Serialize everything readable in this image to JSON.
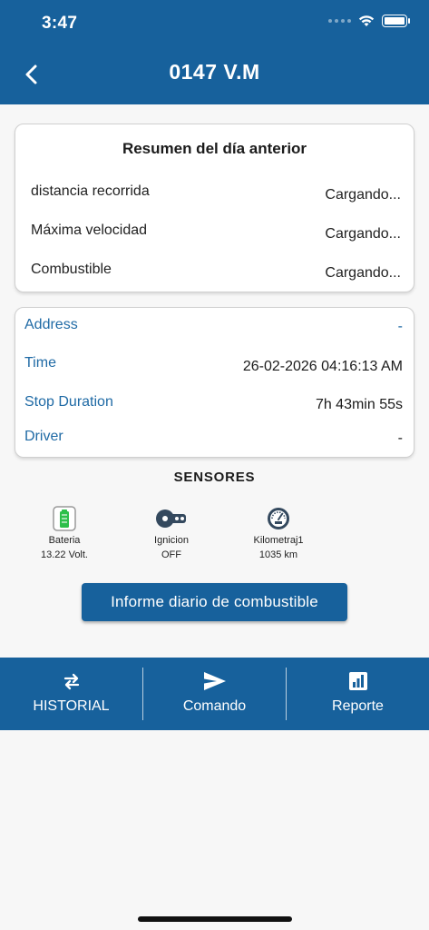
{
  "status_bar": {
    "time": "3:47"
  },
  "header": {
    "title": "0147 V.M"
  },
  "summary": {
    "title": "Resumen del día anterior",
    "rows": [
      {
        "label": "distancia recorrida",
        "value": "Cargando..."
      },
      {
        "label": "Máxima velocidad",
        "value": "Cargando..."
      },
      {
        "label": "Combustible",
        "value": "Cargando..."
      }
    ]
  },
  "info": {
    "rows": [
      {
        "label": "Address",
        "value": "-"
      },
      {
        "label": "Time",
        "value": "26-02-2026 04:16:13 AM"
      },
      {
        "label": "Stop Duration",
        "value": "7h 43min 55s"
      },
      {
        "label": "Driver",
        "value": "-"
      }
    ]
  },
  "sensors": {
    "title": "SENSORES",
    "items": [
      {
        "name": "Bateria",
        "value": "13.22 Volt.",
        "icon": "battery-icon"
      },
      {
        "name": "Ignicion",
        "value": "OFF",
        "icon": "ignition-key-icon"
      },
      {
        "name": "Kilometraj1",
        "value": "1035 km",
        "icon": "odometer-icon"
      }
    ]
  },
  "fuel_report_button": "Informe diario de combustible",
  "bottom_nav": [
    {
      "label": "HISTORIAL",
      "icon": "history-arrows-icon"
    },
    {
      "label": "Comando",
      "icon": "send-icon"
    },
    {
      "label": "Reporte",
      "icon": "report-chart-icon"
    }
  ],
  "colors": {
    "primary": "#17619c",
    "label_blue": "#1f6aa5",
    "background": "#f7f7f7",
    "battery_green": "#2cbf4a"
  }
}
